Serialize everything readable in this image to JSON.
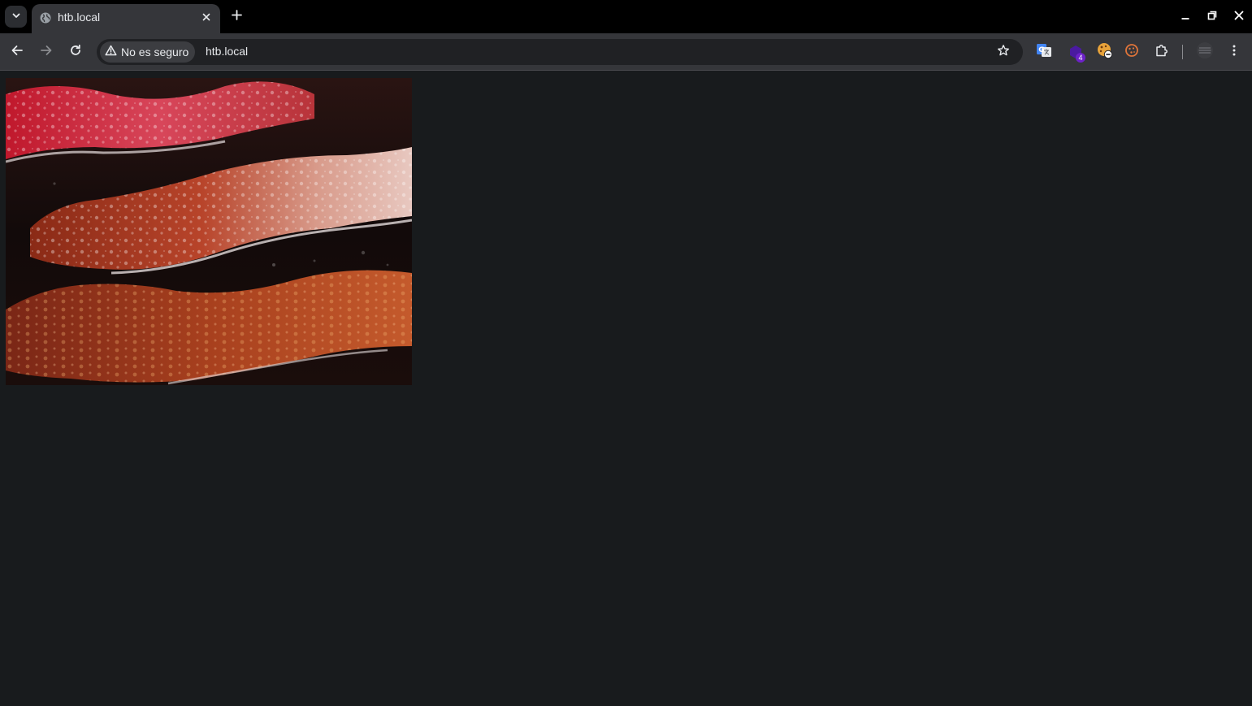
{
  "browser": {
    "tab": {
      "title": "htb.local",
      "favicon_icon": "globe-icon"
    },
    "omnibox": {
      "security_label": "No es seguro",
      "url": "htb.local"
    },
    "extensions": [
      {
        "name": "translate-icon"
      },
      {
        "name": "purple-extension-icon",
        "badge": "4"
      },
      {
        "name": "cookie-editor-icon"
      },
      {
        "name": "cookie-icon"
      },
      {
        "name": "extensions-puzzle-icon"
      }
    ],
    "colors": {
      "tabstrip": "#000000",
      "toolbar": "#35363a",
      "page_background": "#181b1d"
    }
  },
  "page": {
    "image": {
      "subject": "bacon-strips-frying-image"
    }
  }
}
